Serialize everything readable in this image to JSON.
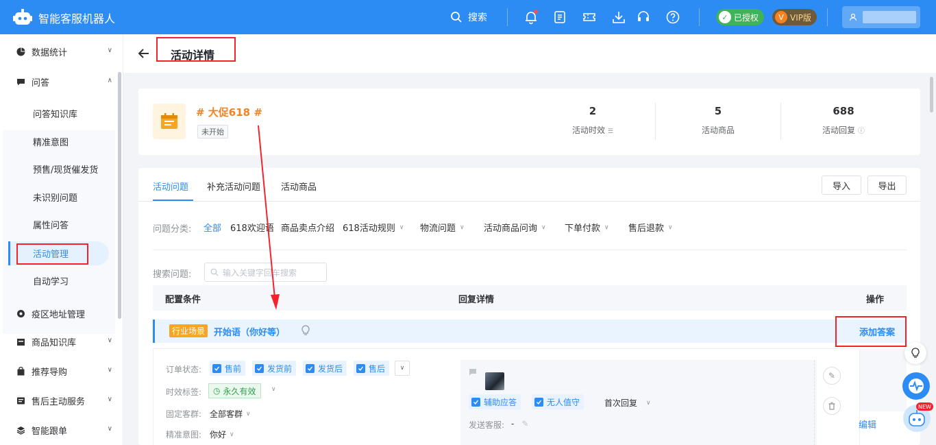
{
  "header": {
    "app_name": "智能客服机器人",
    "search_label": "搜索",
    "auth_badge": "已授权",
    "vip_badge": "VIP版",
    "accent": "#2c8cf4"
  },
  "sidebar": {
    "items": [
      {
        "label": "数据统计",
        "icon": "pie-chart-icon"
      },
      {
        "label": "问答",
        "icon": "chat-icon"
      },
      {
        "label": "疫区地址管理",
        "icon": "location-icon"
      },
      {
        "label": "商品知识库",
        "icon": "box-icon"
      },
      {
        "label": "推荐导购",
        "icon": "bag-icon"
      },
      {
        "label": "售后主动服务",
        "icon": "service-icon"
      },
      {
        "label": "智能跟单",
        "icon": "layers-icon"
      }
    ],
    "sub_items": [
      "问答知识库",
      "精准意图",
      "预售/现货催发货",
      "未识别问题",
      "属性问答",
      "活动管理",
      "自动学习"
    ]
  },
  "page": {
    "title": "活动详情"
  },
  "activity": {
    "name": "# 大促618 #",
    "status": "未开始",
    "stats": [
      {
        "value": "2",
        "label": "活动时效"
      },
      {
        "value": "5",
        "label": "活动商品"
      },
      {
        "value": "688",
        "label": "活动回复"
      }
    ]
  },
  "tabs": [
    "活动问题",
    "补充活动问题",
    "活动商品"
  ],
  "buttons": {
    "import": "导入",
    "export": "导出"
  },
  "filter": {
    "label": "问题分类:",
    "items": [
      "全部",
      "618欢迎语",
      "商品卖点介绍",
      "618活动规则",
      "物流问题",
      "活动商品问询",
      "下单付款",
      "售后退款"
    ]
  },
  "search": {
    "label": "搜索问题:",
    "placeholder": "输入关键字回车搜索"
  },
  "table": {
    "headers": [
      "配置条件",
      "回复详情",
      "操作"
    ]
  },
  "scene": {
    "tag": "行业场景",
    "title": "开始语（你好等）",
    "add_answer": "添加答案"
  },
  "detail": {
    "order_status_label": "订单状态:",
    "order_status": [
      "售前",
      "发货前",
      "发货后",
      "售后"
    ],
    "time_tag_label": "时效标签:",
    "time_tag": "永久有效",
    "fixed_group_label": "固定客群:",
    "fixed_group": "全部客群",
    "intent_label": "精准意图:",
    "intent": "你好",
    "reply_flags": [
      "辅助应答",
      "无人值守"
    ],
    "reply_type": "首次回复",
    "send_agent_label": "发送客服:",
    "send_agent": "-",
    "edit_link": "编辑"
  },
  "float": {
    "new_badge": "NEW"
  }
}
